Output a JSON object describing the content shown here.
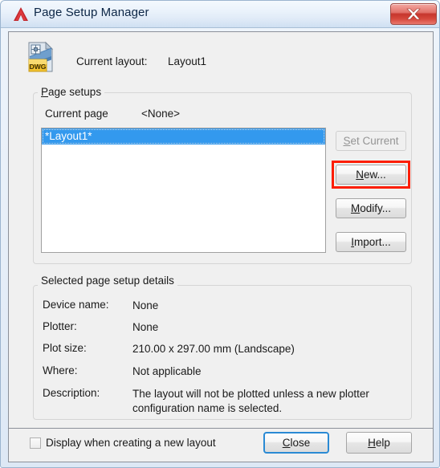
{
  "window": {
    "title": "Page Setup Manager",
    "logo_icon": "autocad-a-logo",
    "close_icon": "close-x-icon",
    "close_label": "X"
  },
  "header": {
    "file_icon": "dwg-file-icon",
    "current_layout_label": "Current layout:",
    "current_layout_value": "Layout1"
  },
  "page_setups": {
    "group_label": "Page setups",
    "group_label_accel": "P",
    "current_page_label": "Current page",
    "current_page_value": "<None>",
    "list_items": [
      {
        "label": "*Layout1*",
        "selected": true
      }
    ],
    "buttons": [
      {
        "id": "set-current",
        "label": "Set Current",
        "accel": "S",
        "enabled": false,
        "highlighted": false
      },
      {
        "id": "new",
        "label": "New...",
        "accel": "N",
        "enabled": true,
        "highlighted": true
      },
      {
        "id": "modify",
        "label": "Modify...",
        "accel": "M",
        "enabled": true,
        "highlighted": false
      },
      {
        "id": "import",
        "label": "Import...",
        "accel": "I",
        "enabled": true,
        "highlighted": false
      }
    ],
    "highlight_color": "#fc1d00",
    "selection_color": "#3399ee"
  },
  "details": {
    "group_label": "Selected page setup details",
    "rows": [
      {
        "label": "Device name:",
        "value": "None"
      },
      {
        "label": "Plotter:",
        "value": "None"
      },
      {
        "label": "Plot size:",
        "value": "210.00 x 297.00 mm (Landscape)"
      },
      {
        "label": "Where:",
        "value": "Not applicable"
      },
      {
        "label": "Description:",
        "value": "The layout will not be plotted unless a new plotter\nconfiguration name is selected."
      }
    ]
  },
  "footer": {
    "checkbox_label": "Display when creating a new layout",
    "checkbox_checked": false,
    "close_label": "Close",
    "close_accel": "C",
    "help_label": "Help",
    "help_accel": "H"
  }
}
